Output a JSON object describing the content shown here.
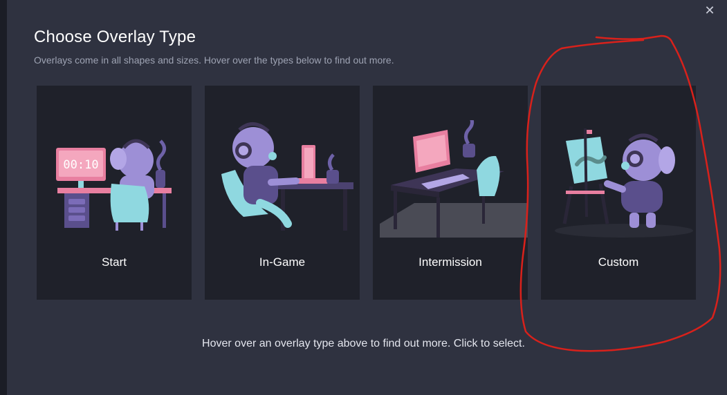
{
  "dialog": {
    "close_icon": "close-icon",
    "title": "Choose Overlay Type",
    "subtitle": "Overlays come in all shapes and sizes. Hover over the types below to find out more.",
    "hint": "Hover over an overlay type above to find out more. Click to select."
  },
  "overlay_types": [
    {
      "label": "Start",
      "illustration": "timer-desk-illustration"
    },
    {
      "label": "In-Game",
      "illustration": "gaming-desk-illustration"
    },
    {
      "label": "Intermission",
      "illustration": "empty-desk-illustration"
    },
    {
      "label": "Custom",
      "illustration": "painter-easel-illustration"
    }
  ],
  "timer_display": "00:10",
  "colors": {
    "background": "#2f3240",
    "card": "#1f212a",
    "mascot": "#9d8fd6",
    "accent_pink": "#e87fa0",
    "accent_cyan": "#8fd8e0",
    "annotation": "#d9211b"
  }
}
